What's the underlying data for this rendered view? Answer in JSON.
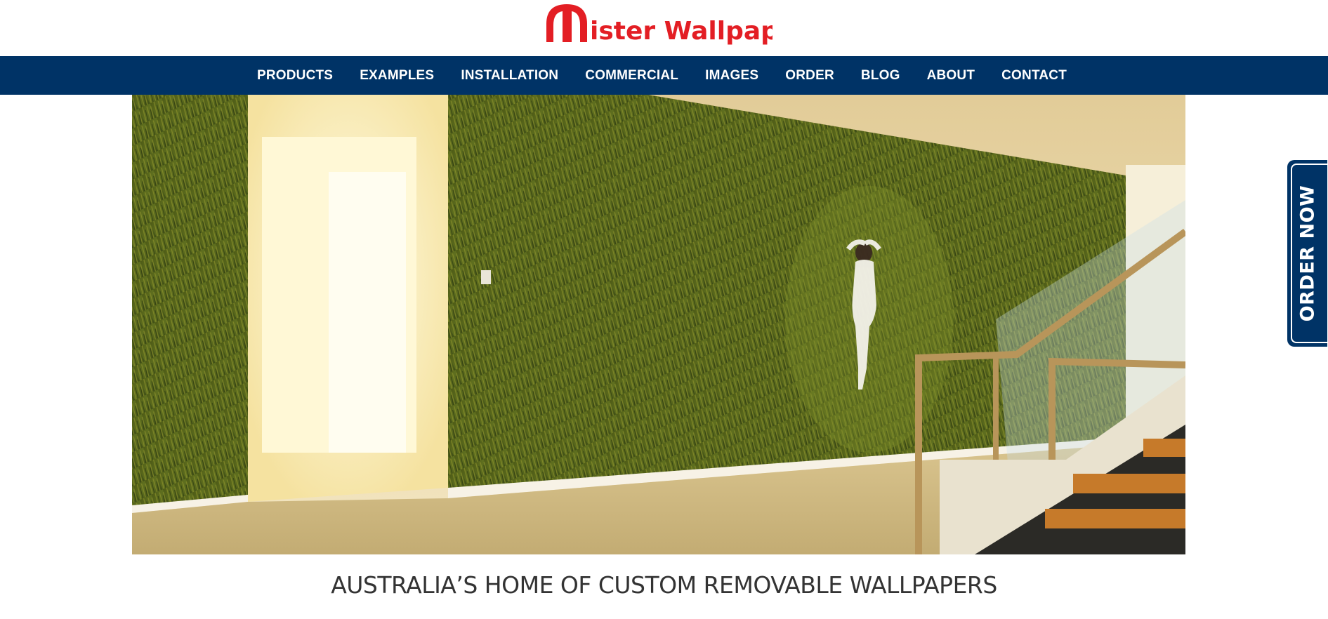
{
  "brand": {
    "logo_text": "Mister Wallpaper",
    "logo_color": "#e31e24"
  },
  "nav": {
    "items": [
      {
        "label": "PRODUCTS"
      },
      {
        "label": "EXAMPLES"
      },
      {
        "label": "INSTALLATION"
      },
      {
        "label": "COMMERCIAL"
      },
      {
        "label": "IMAGES"
      },
      {
        "label": "ORDER"
      },
      {
        "label": "BLOG"
      },
      {
        "label": "ABOUT"
      },
      {
        "label": "CONTACT"
      }
    ],
    "background": "#003366"
  },
  "order_tab": {
    "label": "ORDER NOW"
  },
  "tagline": "AUSTRALIA’S HOME OF CUSTOM REMOVABLE WALLPAPERS"
}
